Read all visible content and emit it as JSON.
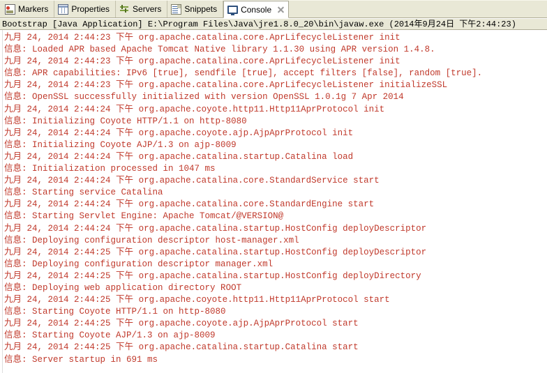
{
  "window": {
    "title": "Console"
  },
  "tabs": [
    {
      "label": "Markers",
      "icon": "markers-icon",
      "active": false,
      "closable": false
    },
    {
      "label": "Properties",
      "icon": "properties-icon",
      "active": false,
      "closable": false
    },
    {
      "label": "Servers",
      "icon": "servers-icon",
      "active": false,
      "closable": false
    },
    {
      "label": "Snippets",
      "icon": "snippets-icon",
      "active": false,
      "closable": false
    },
    {
      "label": "Console",
      "icon": "console-icon",
      "active": true,
      "closable": true
    }
  ],
  "launch_header": {
    "text": "Bootstrap [Java Application] E:\\Program Files\\Java\\jre1.8.0_20\\bin\\javaw.exe (2014年9月24日 下午2:44:23)",
    "process": "Bootstrap",
    "launch_type": "Java Application",
    "command": "E:\\Program Files\\Java\\jre1.8.0_20\\bin\\javaw.exe",
    "timestamp": "2014年9月24日 下午2:44:23"
  },
  "console": {
    "stream": "stderr",
    "text_color": "#c0392b",
    "lines": [
      "九月 24, 2014 2:44:23 下午 org.apache.catalina.core.AprLifecycleListener init",
      "信息: Loaded APR based Apache Tomcat Native library 1.1.30 using APR version 1.4.8.",
      "九月 24, 2014 2:44:23 下午 org.apache.catalina.core.AprLifecycleListener init",
      "信息: APR capabilities: IPv6 [true], sendfile [true], accept filters [false], random [true].",
      "九月 24, 2014 2:44:23 下午 org.apache.catalina.core.AprLifecycleListener initializeSSL",
      "信息: OpenSSL successfully initialized with version OpenSSL 1.0.1g 7 Apr 2014",
      "九月 24, 2014 2:44:24 下午 org.apache.coyote.http11.Http11AprProtocol init",
      "信息: Initializing Coyote HTTP/1.1 on http-8080",
      "九月 24, 2014 2:44:24 下午 org.apache.coyote.ajp.AjpAprProtocol init",
      "信息: Initializing Coyote AJP/1.3 on ajp-8009",
      "九月 24, 2014 2:44:24 下午 org.apache.catalina.startup.Catalina load",
      "信息: Initialization processed in 1047 ms",
      "九月 24, 2014 2:44:24 下午 org.apache.catalina.core.StandardService start",
      "信息: Starting service Catalina",
      "九月 24, 2014 2:44:24 下午 org.apache.catalina.core.StandardEngine start",
      "信息: Starting Servlet Engine: Apache Tomcat/@VERSION@",
      "九月 24, 2014 2:44:24 下午 org.apache.catalina.startup.HostConfig deployDescriptor",
      "信息: Deploying configuration descriptor host-manager.xml",
      "九月 24, 2014 2:44:25 下午 org.apache.catalina.startup.HostConfig deployDescriptor",
      "信息: Deploying configuration descriptor manager.xml",
      "九月 24, 2014 2:44:25 下午 org.apache.catalina.startup.HostConfig deployDirectory",
      "信息: Deploying web application directory ROOT",
      "九月 24, 2014 2:44:25 下午 org.apache.coyote.http11.Http11AprProtocol start",
      "信息: Starting Coyote HTTP/1.1 on http-8080",
      "九月 24, 2014 2:44:25 下午 org.apache.coyote.ajp.AjpAprProtocol start",
      "信息: Starting Coyote AJP/1.3 on ajp-8009",
      "九月 24, 2014 2:44:25 下午 org.apache.catalina.startup.Catalina start",
      "信息: Server startup in 691 ms"
    ]
  }
}
